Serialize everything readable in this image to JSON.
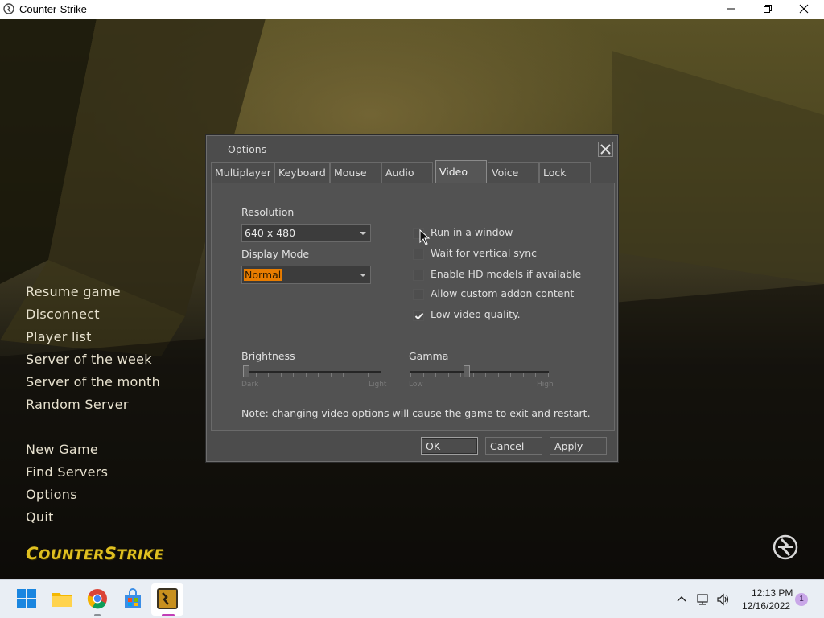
{
  "window": {
    "title": "Counter-Strike",
    "buttons": [
      "minimize",
      "maximize",
      "close"
    ]
  },
  "main_menu": {
    "items_group1": [
      "Resume game",
      "Disconnect",
      "Player list",
      "Server of the week",
      "Server of the month",
      "Random Server"
    ],
    "items_group2": [
      "New Game",
      "Find Servers",
      "Options",
      "Quit"
    ],
    "logo_text": "Counter-Strike"
  },
  "options_dialog": {
    "title": "Options",
    "tabs": [
      "Multiplayer",
      "Keyboard",
      "Mouse",
      "Audio",
      "Video",
      "Voice",
      "Lock"
    ],
    "active_tab": "Video",
    "resolution_label": "Resolution",
    "resolution_value": "640 x 480",
    "display_mode_label": "Display Mode",
    "display_mode_value": "Normal",
    "checkboxes": [
      {
        "label": "Run in a window",
        "checked": false
      },
      {
        "label": "Wait for vertical sync",
        "checked": false
      },
      {
        "label": "Enable HD models if available",
        "checked": false
      },
      {
        "label": "Allow custom addon content",
        "checked": false
      },
      {
        "label": "Low video quality.",
        "checked": true
      }
    ],
    "brightness": {
      "label": "Brightness",
      "min_label": "Dark",
      "max_label": "Light",
      "level": 0.0
    },
    "gamma": {
      "label": "Gamma",
      "min_label": "Low",
      "max_label": "High",
      "level": 0.4
    },
    "note": "Note: changing video options will cause the game to exit and restart.",
    "ok_label": "OK",
    "cancel_label": "Cancel",
    "apply_label": "Apply"
  },
  "taskbar": {
    "apps": [
      "start-icon",
      "file-explorer-icon",
      "chrome-icon",
      "store-icon",
      "counter-strike-icon"
    ],
    "time": "12:13 PM",
    "date": "12/16/2022",
    "notification_count": "1"
  },
  "colors": {
    "dialog_bg": "#4c4c4c",
    "selection_orange": "#e87c00",
    "logo_yellow": "#e0c020",
    "taskbar_bg": "#e9eef4"
  }
}
